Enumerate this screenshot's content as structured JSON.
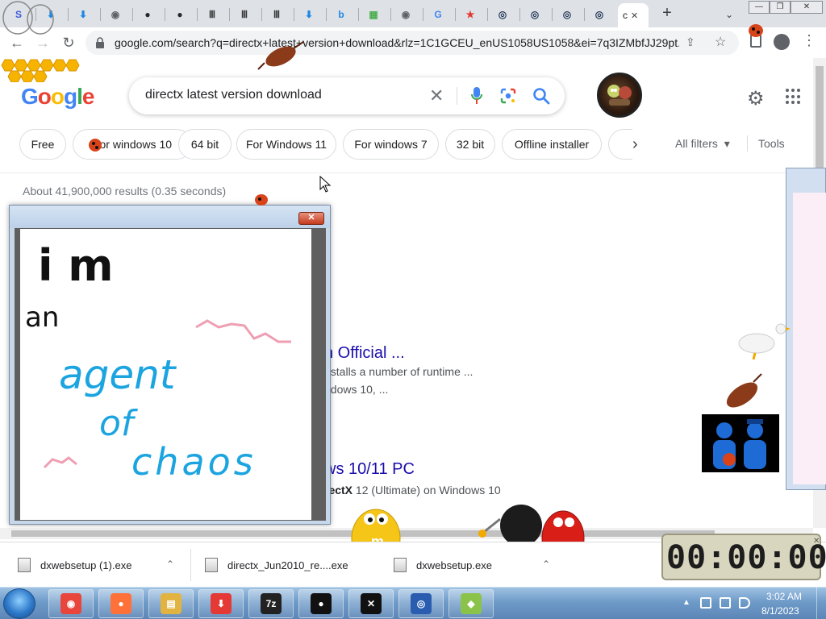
{
  "window_controls": {
    "minimize": "—",
    "restore": "❐",
    "close": "✕"
  },
  "browser": {
    "tabs": [
      {
        "icon": "s-logo-icon",
        "glyph": "S",
        "color": "#3b5bdb"
      },
      {
        "icon": "download-arrow-icon",
        "glyph": "⬇",
        "color": "#1e88e5"
      },
      {
        "icon": "download-arrow-icon",
        "glyph": "⬇",
        "color": "#1e88e5"
      },
      {
        "icon": "globe-icon",
        "glyph": "◉",
        "color": "#5f6368"
      },
      {
        "icon": "github-icon",
        "glyph": "●",
        "color": "#24292f"
      },
      {
        "icon": "github-icon",
        "glyph": "●",
        "color": "#24292f"
      },
      {
        "icon": "archive-icon",
        "glyph": "Ⅲ",
        "color": "#333333"
      },
      {
        "icon": "archive-icon",
        "glyph": "Ⅲ",
        "color": "#333333"
      },
      {
        "icon": "archive-icon",
        "glyph": "Ⅲ",
        "color": "#333333"
      },
      {
        "icon": "download-arrow-icon",
        "glyph": "⬇",
        "color": "#1e88e5"
      },
      {
        "icon": "bing-icon",
        "glyph": "b",
        "color": "#1e88e5"
      },
      {
        "icon": "microsoft-icon",
        "glyph": "▦",
        "color": "#4caf50"
      },
      {
        "icon": "globe-icon",
        "glyph": "◉",
        "color": "#5f6368"
      },
      {
        "icon": "google-icon",
        "glyph": "G",
        "color": "#4285f4"
      },
      {
        "icon": "star-icon",
        "glyph": "★",
        "color": "#e53935"
      },
      {
        "icon": "search-site-icon",
        "glyph": "◎",
        "color": "#263a5a"
      },
      {
        "icon": "search-site-icon",
        "glyph": "◎",
        "color": "#263a5a"
      },
      {
        "icon": "search-site-icon",
        "glyph": "◎",
        "color": "#263a5a"
      },
      {
        "icon": "search-site-icon",
        "glyph": "◎",
        "color": "#263a5a"
      }
    ],
    "active_tab": {
      "label": "c",
      "close": "✕"
    },
    "new_tab": "+",
    "tab_search": "⌄",
    "url": "google.com/search?q=directx+latest+version+download&rlz=1C1GCEU_enUS1058US1058&ei=7q3IZMbfJJ29pt...",
    "share_glyph": "⇪",
    "star_glyph": "☆",
    "menu_glyph": "⋮",
    "back_glyph": "←",
    "forward_glyph": "→",
    "reload_glyph": "↻"
  },
  "google": {
    "logo_letters": [
      {
        "ch": "G",
        "color": "#4285f4"
      },
      {
        "ch": "o",
        "color": "#ea4335"
      },
      {
        "ch": "o",
        "color": "#fbbc05"
      },
      {
        "ch": "g",
        "color": "#4285f4"
      },
      {
        "ch": "l",
        "color": "#34a853"
      },
      {
        "ch": "e",
        "color": "#ea4335"
      }
    ],
    "query": "directx latest version download",
    "clear_glyph": "✕",
    "settings_glyph": "⚙"
  },
  "chips": [
    "Free",
    "For windows 10",
    "64 bit",
    "For Windows 11",
    "For windows 7",
    "32 bit",
    "Offline installer"
  ],
  "filters": {
    "next_glyph": "›",
    "all_filters": "All filters",
    "dropdown_glyph": "▾",
    "tools": "Tools"
  },
  "results": {
    "stats": "About 41,900,000 results (0.35 seconds)",
    "r1_title": "n Official ...",
    "r1_line1": "nstalls a number of runtime ...",
    "r1_line2": "ndows 10, ...",
    "r2_title": "ws 10/11 PC",
    "r2_line_bold": "rectX",
    "r2_line_rest": " 12 (Ultimate) on Windows 10"
  },
  "paint": {
    "close_glyph": "✕",
    "handwriting": {
      "l1": "i m",
      "l2": "an",
      "l3": "agent",
      "l4": "of",
      "l5": "chaos"
    },
    "ink_black": "#111111",
    "ink_blue": "#1ba4e0",
    "ink_pink": "#ef9fb3"
  },
  "downloads": [
    {
      "name": "dxwebsetup (1).exe"
    },
    {
      "name": "directx_Jun2010_re....exe"
    },
    {
      "name": "dxwebsetup.exe"
    }
  ],
  "download_chevron": "⌃",
  "timer": {
    "value": "00:00:00",
    "close": "✕"
  },
  "taskbar": {
    "apps": [
      {
        "name": "chrome",
        "glyph": "◉",
        "color": "#e8453c"
      },
      {
        "name": "firefox",
        "glyph": "●",
        "color": "#ff7139"
      },
      {
        "name": "explorer",
        "glyph": "▤",
        "color": "#e3b341"
      },
      {
        "name": "download-manager",
        "glyph": "⬇",
        "color": "#e53935"
      },
      {
        "name": "7zip",
        "glyph": "7z",
        "color": "#222222"
      },
      {
        "name": "badtz-maru",
        "glyph": "●",
        "color": "#111111"
      },
      {
        "name": "lightsaber",
        "glyph": "✕",
        "color": "#111111"
      },
      {
        "name": "magnifier",
        "glyph": "◎",
        "color": "#2a5db0"
      },
      {
        "name": "goose",
        "glyph": "◆",
        "color": "#8bc34a"
      }
    ],
    "tray_up": "▲",
    "time": "3:02 AM",
    "date": "8/1/2023"
  }
}
